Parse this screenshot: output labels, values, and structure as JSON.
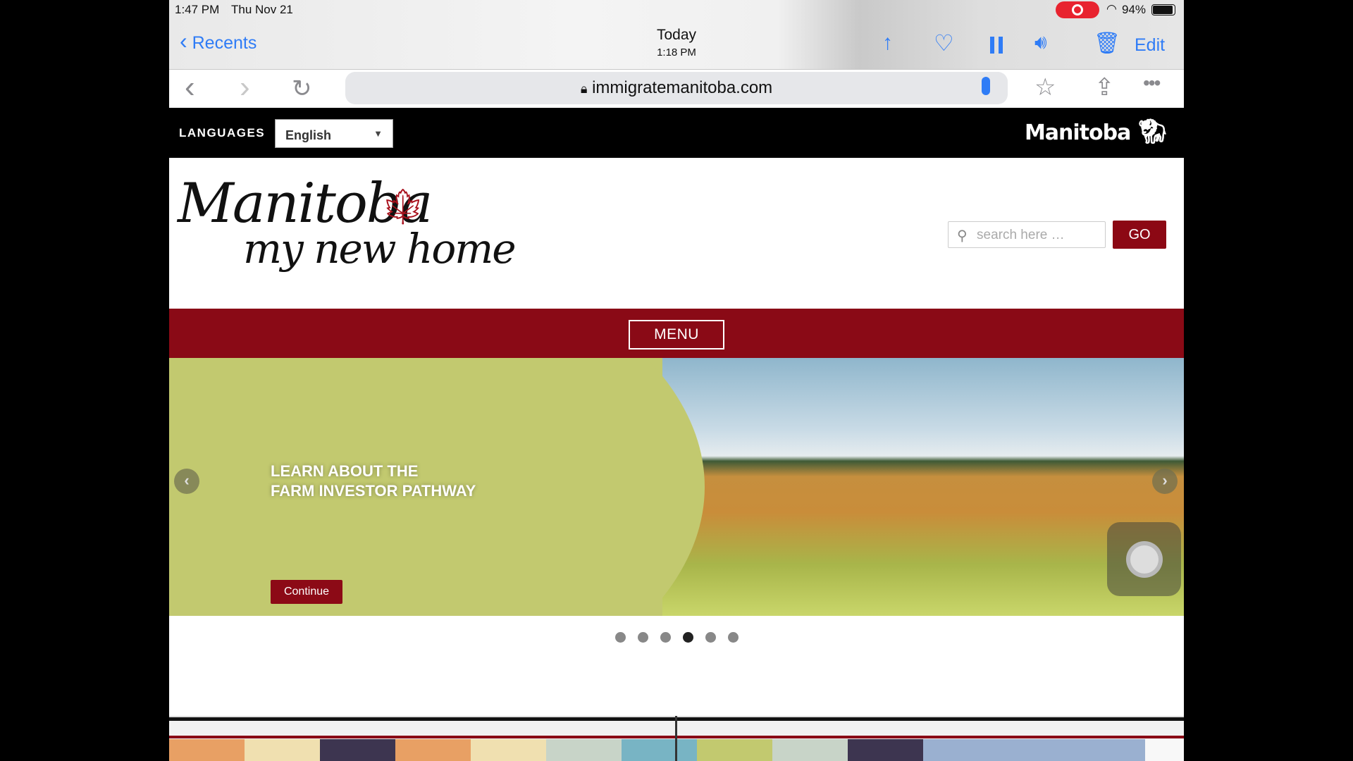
{
  "status_bar": {
    "time": "1:47 PM",
    "date": "Thu Nov 21",
    "battery": "94%"
  },
  "nav": {
    "back_label": "Recents",
    "title": "Today",
    "subtitle": "1:18 PM",
    "edit_label": "Edit"
  },
  "browser": {
    "url": "immigratemanitoba.com"
  },
  "header": {
    "languages_label": "LANGUAGES",
    "language_selected": "English",
    "gov_logo_text": "Manitoba"
  },
  "logo": {
    "line1": "Manitoba",
    "line2": "my new home"
  },
  "search": {
    "placeholder": "search here …",
    "go_label": "GO"
  },
  "menu": {
    "label": "MENU"
  },
  "slide": {
    "line1": "LEARN ABOUT THE",
    "line2": "FARM INVESTOR PATHWAY",
    "button": "Continue",
    "active_index": 4,
    "count": 6
  },
  "colors": {
    "brand_red": "#8a0a16",
    "slide_green": "#c2c96f",
    "ios_blue": "#2f7cf6"
  },
  "filmstrip": {
    "thumb_colors": [
      "#e8a064",
      "#f0e0b0",
      "#3d3550",
      "#e8a064",
      "#f0e0b0",
      "#c8d4c8",
      "#78b4c4",
      "#c2c96f",
      "#c8d4c8",
      "#3d3550",
      "#9ab0d0",
      "#9ab0d0",
      "#9ab0d0",
      "#f8f8f8"
    ]
  }
}
